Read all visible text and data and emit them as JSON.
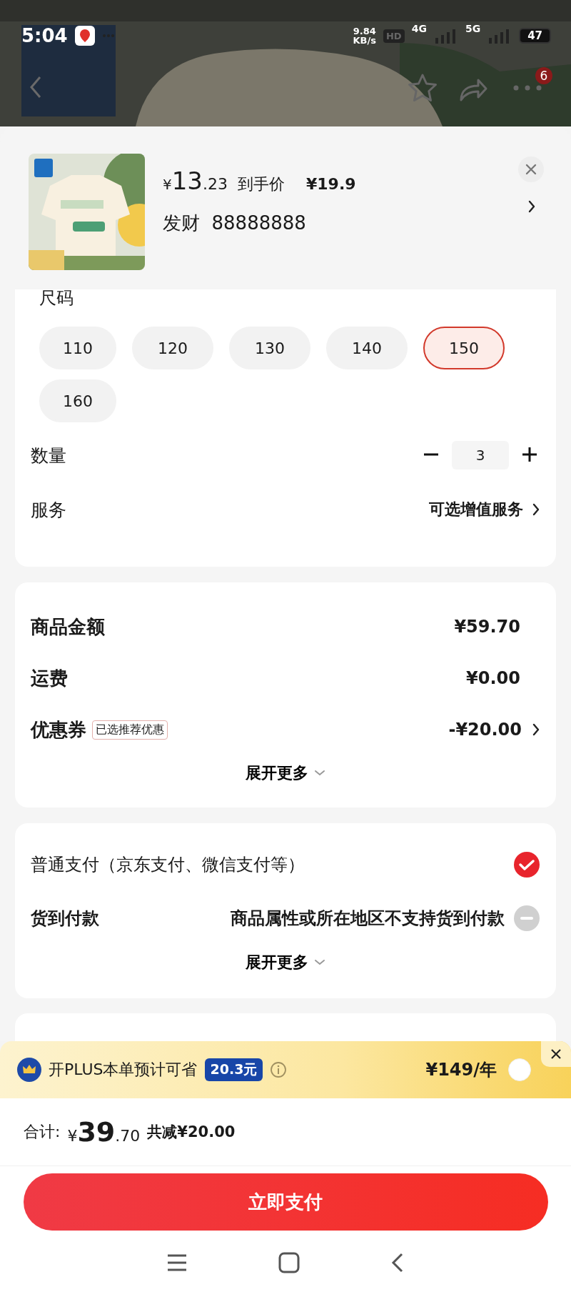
{
  "status_bar": {
    "time": "5:04",
    "speed": "9.84",
    "speed_unit": "KB/s",
    "hd": "HD",
    "net_1": "4G",
    "net_2": "5G",
    "battery": "47"
  },
  "top_bar": {
    "badge": "6"
  },
  "product": {
    "currency": "¥",
    "price_integer": "13",
    "price_decimal": ".23",
    "price_label": "到手价",
    "original_price": "¥19.9",
    "variant": "发财  88888888"
  },
  "size_label": "尺码",
  "sizes": [
    {
      "label": "110",
      "selected": false
    },
    {
      "label": "120",
      "selected": false
    },
    {
      "label": "130",
      "selected": false
    },
    {
      "label": "140",
      "selected": false
    },
    {
      "label": "150",
      "selected": true
    },
    {
      "label": "160",
      "selected": false
    }
  ],
  "quantity": {
    "label": "数量",
    "value": "3"
  },
  "service": {
    "label": "服务",
    "value": "可选增值服务"
  },
  "summary": {
    "rows": [
      {
        "label": "商品金额",
        "value": "¥59.70",
        "link": false
      },
      {
        "label": "运费",
        "value": "¥0.00",
        "link": false
      },
      {
        "label": "优惠券",
        "tag": "已选推荐优惠",
        "value": "-¥20.00",
        "link": true
      }
    ],
    "more": "展开更多"
  },
  "payment": {
    "methods": [
      {
        "label": "普通支付（京东支付、微信支付等）",
        "selected": true,
        "disabled": false
      },
      {
        "label": "货到付款",
        "note": "商品属性或所在地区不支持货到付款",
        "selected": false,
        "disabled": true
      }
    ],
    "more": "展开更多"
  },
  "plus": {
    "text": "开PLUS本单预计可省",
    "saving": "20.3元",
    "price": "¥149/年",
    "selected": false
  },
  "footer": {
    "total_label": "合计:",
    "currency": "¥",
    "total_integer": "39",
    "total_decimal": ".70",
    "discount": "共减¥20.00",
    "pay_button": "立即支付"
  }
}
